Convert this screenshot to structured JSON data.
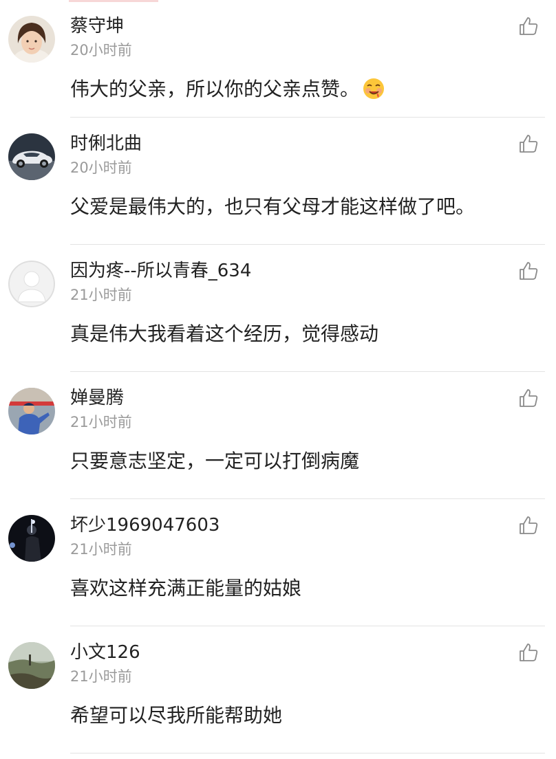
{
  "comments": [
    {
      "username": "蔡守坤",
      "time": "20小时前",
      "text": "伟大的父亲，所以你的父亲点赞。",
      "emoji": "drooling-face-icon"
    },
    {
      "username": "时俐北曲",
      "time": "20小时前",
      "text": "父爱是最伟大的，也只有父母才能这样做了吧。"
    },
    {
      "username": "因为疼--所以青春_634",
      "time": "21小时前",
      "text": "真是伟大我看着这个经历，觉得感动"
    },
    {
      "username": "婵曼腾",
      "time": "21小时前",
      "text": "只要意志坚定，一定可以打倒病魔"
    },
    {
      "username": "坏少1969047603",
      "time": "21小时前",
      "text": "喜欢这样充满正能量的姑娘"
    },
    {
      "username": "小文126",
      "time": "21小时前",
      "text": "希望可以尽我所能帮助她"
    }
  ],
  "icons": {
    "like": "thumbs-up-outline-icon"
  },
  "colors": {
    "text": "#222222",
    "muted": "#9a9a9a",
    "divider": "#e3e3e3",
    "accent": "#f7d7d7"
  }
}
